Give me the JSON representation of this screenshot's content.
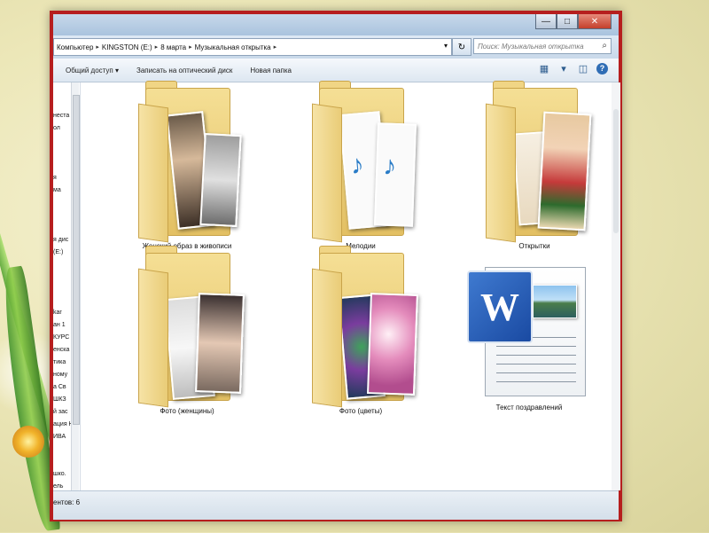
{
  "window": {
    "buttons": {
      "minimize": "—",
      "maximize": "□",
      "close": "✕"
    }
  },
  "address": {
    "crumbs": [
      "Компьютер",
      "KINGSTON (E:)",
      "8 марта",
      "Музыкальная открытка"
    ],
    "separator": "▸",
    "dropdown": "▾",
    "refresh": "↻"
  },
  "search": {
    "placeholder": "Поиск: Музыкальная открытка",
    "icon": "search-icon"
  },
  "toolbar": {
    "share": "Общий доступ ▾",
    "burn": "Записать на оптический диск",
    "new_folder": "Новая папка",
    "view_icon": "▦",
    "view_dd": "▾",
    "preview_icon": "◫",
    "help_icon": "?"
  },
  "navpane": {
    "items": [
      "неста",
      "ол",
      "я",
      "ма",
      "я дис",
      "(E:)",
      "kar",
      "ан 1",
      "КУРС",
      "енска",
      "тика",
      "ному",
      "а Св",
      "ШКЗ",
      "й зас",
      "ация Н",
      "ИВА",
      "шко.",
      "ель"
    ]
  },
  "files": [
    {
      "name": "Женский образ в живописи",
      "type": "folder"
    },
    {
      "name": "Мелодии",
      "type": "folder"
    },
    {
      "name": "Открытки",
      "type": "folder"
    },
    {
      "name": "Фото (женщины)",
      "type": "folder"
    },
    {
      "name": "Фото (цветы)",
      "type": "folder"
    },
    {
      "name": "Текст поздравлений",
      "type": "word-document",
      "logo_letter": "W"
    }
  ],
  "status": {
    "text": "ентов: 6"
  },
  "colors": {
    "frame": "#b61e1e",
    "folder": "#f0d585",
    "word": "#1a4aa2"
  }
}
